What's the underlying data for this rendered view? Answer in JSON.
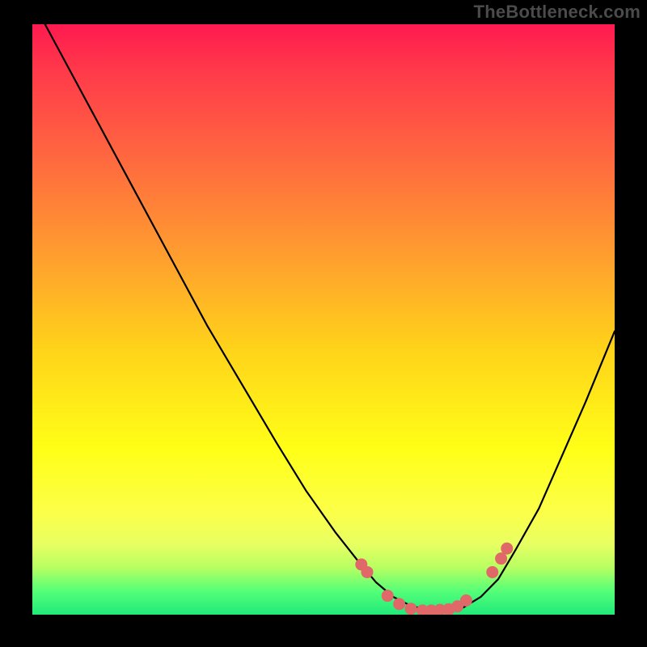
{
  "watermark": "TheBottleneck.com",
  "chart_data": {
    "type": "line",
    "title": "",
    "xlabel": "",
    "ylabel": "",
    "xlim": [
      0,
      100
    ],
    "ylim": [
      0,
      100
    ],
    "series": [
      {
        "name": "curve",
        "x": [
          0,
          6,
          12,
          18,
          24,
          30,
          36,
          42,
          47,
          52,
          56,
          59,
          62,
          65,
          68,
          71,
          74,
          77,
          80,
          83,
          87,
          91,
          95,
          100
        ],
        "y": [
          104,
          93,
          82,
          71,
          60,
          49,
          39,
          29,
          21,
          14,
          9,
          5.5,
          3,
          1.5,
          0.8,
          0.7,
          1.2,
          3,
          6,
          11,
          18,
          27,
          36,
          48
        ]
      }
    ],
    "markers": {
      "name": "dots",
      "x": [
        56.5,
        57.5,
        61,
        63,
        65,
        67,
        68.5,
        70,
        71.5,
        73,
        74.5,
        79,
        80.5,
        81.5
      ],
      "y": [
        8.5,
        7.2,
        3.2,
        1.8,
        1.0,
        0.7,
        0.7,
        0.8,
        0.9,
        1.4,
        2.4,
        7.2,
        9.5,
        11.2
      ]
    },
    "background_gradient": {
      "top": "#ff1a50",
      "mid": "#ffd31a",
      "bottom": "#20e97a"
    }
  }
}
